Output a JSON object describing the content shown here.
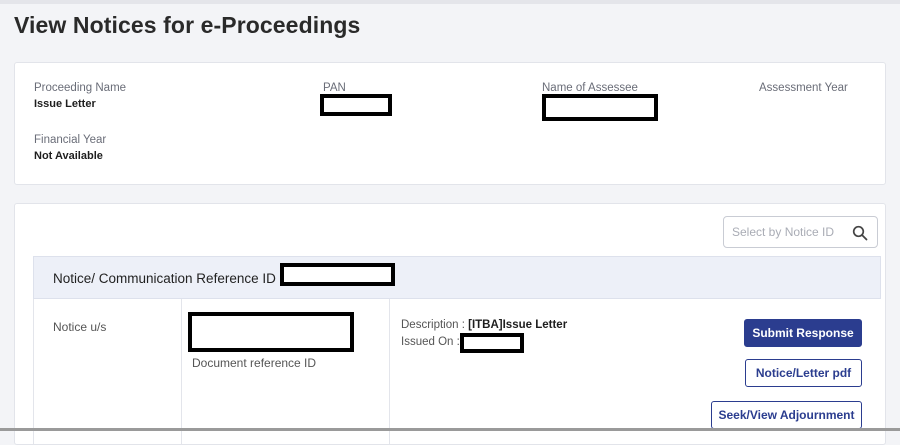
{
  "page": {
    "title": "View Notices for e-Proceedings"
  },
  "details": {
    "proceeding_name_label": "Proceeding Name",
    "proceeding_name_value": "Issue Letter",
    "pan_label": "PAN",
    "assessee_label": "Name of Assessee",
    "assessment_year_label": "Assessment Year",
    "financial_year_label": "Financial Year",
    "financial_year_value": "Not Available"
  },
  "notice": {
    "search_placeholder": "Select by Notice ID",
    "reference_label": "Notice/ Communication Reference ID :",
    "notice_us_label": "Notice u/s",
    "document_reference_label": "Document reference ID",
    "description_label": "Description :",
    "description_value": "[ITBA]Issue Letter",
    "issued_on_label": "Issued On :"
  },
  "actions": {
    "submit_response": "Submit Response",
    "notice_pdf": "Notice/Letter pdf",
    "seek_adjournment": "Seek/View Adjournment"
  },
  "colors": {
    "primary": "#2b3d8f",
    "reference_bar": "#edf0f8",
    "page_background": "#f3f4f7"
  },
  "icons": {
    "search": "search-icon"
  }
}
